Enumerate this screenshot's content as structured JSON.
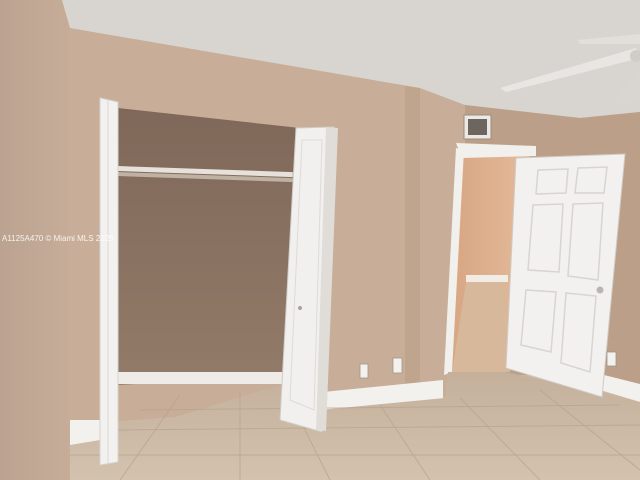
{
  "photo": {
    "subject": "empty bedroom",
    "watermark": "A1125A470 © Miami MLS 2025"
  },
  "colors": {
    "ceiling": "#d9d6d2",
    "wall_main": "#c9b09a",
    "wall_shadow": "#b79c86",
    "closet_interior": "#8f7766",
    "floor_tile": "#cbb9a4",
    "grout": "#b7a390",
    "door_white": "#f1f0ee",
    "baseboard": "#f4f3f1",
    "hall_wall": "#dcb08e"
  }
}
